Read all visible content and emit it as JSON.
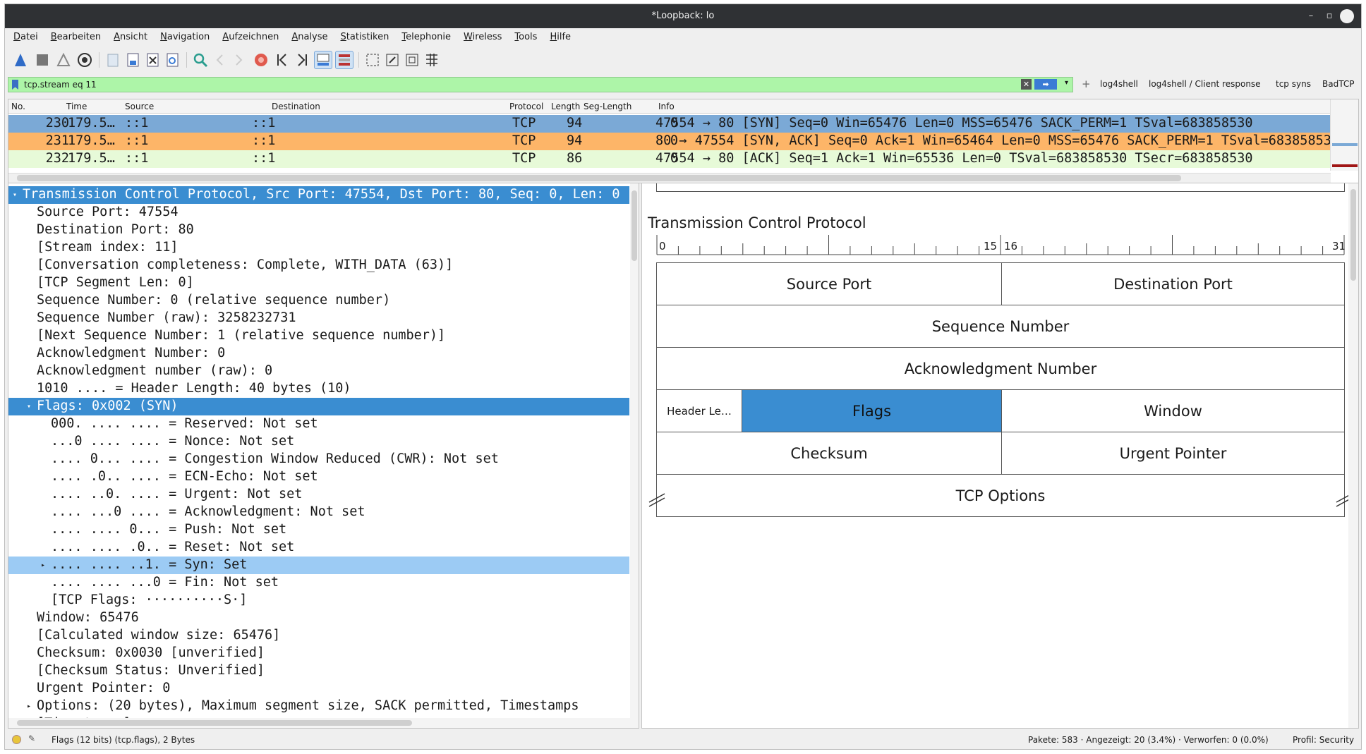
{
  "window": {
    "title": "*Loopback: lo",
    "minimize": "–",
    "maximize": "▫"
  },
  "menu": [
    "Datei",
    "Bearbeiten",
    "Ansicht",
    "Navigation",
    "Aufzeichnen",
    "Analyse",
    "Statistiken",
    "Telephonie",
    "Wireless",
    "Tools",
    "Hilfe"
  ],
  "filter": {
    "value": "tcp.stream eq 11",
    "add": "+",
    "buttons": [
      "log4shell",
      "log4shell / Client response",
      "tcp syns",
      "BadTCP"
    ]
  },
  "packet_list": {
    "columns": [
      "No.",
      "Time",
      "Source",
      "Destination",
      "Protocol",
      "Length",
      "Seg-Length",
      "Info"
    ],
    "rows": [
      {
        "no": "230",
        "time": "179.5…",
        "src": "::1",
        "dst": "::1",
        "proto": "TCP",
        "len": "94",
        "seglen": "0",
        "info": "47554 → 80 [SYN] Seq=0 Win=65476 Len=0 MSS=65476 SACK_PERM=1 TSval=683858530",
        "color": "#7ba9d6"
      },
      {
        "no": "231",
        "time": "179.5…",
        "src": "::1",
        "dst": "::1",
        "proto": "TCP",
        "len": "94",
        "seglen": "0",
        "info": "80 → 47554 [SYN, ACK] Seq=0 Ack=1 Win=65464 Len=0 MSS=65476 SACK_PERM=1 TSval=683858530",
        "color": "#fdb568"
      },
      {
        "no": "232",
        "time": "179.5…",
        "src": "::1",
        "dst": "::1",
        "proto": "TCP",
        "len": "86",
        "seglen": "0",
        "info": "47554 → 80 [ACK] Seq=1 Ack=1 Win=65536 Len=0 TSval=683858530 TSecr=683858530",
        "color": "#e7fad8"
      }
    ]
  },
  "tree": [
    "Transmission Control Protocol, Src Port: 47554, Dst Port: 80, Seq: 0, Len: 0",
    "Source Port: 47554",
    "Destination Port: 80",
    "[Stream index: 11]",
    "[Conversation completeness: Complete, WITH_DATA (63)]",
    "[TCP Segment Len: 0]",
    "Sequence Number: 0    (relative sequence number)",
    "Sequence Number (raw): 3258232731",
    "[Next Sequence Number: 1    (relative sequence number)]",
    "Acknowledgment Number: 0",
    "Acknowledgment number (raw): 0",
    "1010 .... = Header Length: 40 bytes (10)",
    "Flags: 0x002 (SYN)",
    "000. .... .... = Reserved: Not set",
    "...0 .... .... = Nonce: Not set",
    ".... 0... .... = Congestion Window Reduced (CWR): Not set",
    ".... .0.. .... = ECN-Echo: Not set",
    ".... ..0. .... = Urgent: Not set",
    ".... ...0 .... = Acknowledgment: Not set",
    ".... .... 0... = Push: Not set",
    ".... .... .0.. = Reset: Not set",
    ".... .... ..1. = Syn: Set",
    ".... .... ...0 = Fin: Not set",
    "[TCP Flags: ··········S·]",
    "Window: 65476",
    "[Calculated window size: 65476]",
    "Checksum: 0x0030 [unverified]",
    "[Checksum Status: Unverified]",
    "Urgent Pointer: 0",
    "Options: (20 bytes), Maximum segment size, SACK permitted, Timestamps",
    "[Timestamps]"
  ],
  "diagram": {
    "title": "Transmission Control Protocol",
    "bit_labels": [
      "0",
      "15",
      "16",
      "31"
    ],
    "fields": {
      "src_port": "Source Port",
      "dst_port": "Destination Port",
      "seq": "Sequence Number",
      "ack": "Acknowledgment Number",
      "hdr_len": "Header Le…",
      "flags": "Flags",
      "window": "Window",
      "checksum": "Checksum",
      "urgent": "Urgent Pointer",
      "options": "TCP Options"
    }
  },
  "status": {
    "field": "Flags (12 bits) (tcp.flags), 2 Bytes",
    "stats": "Pakete: 583 · Angezeigt: 20 (3.4%) · Verworfen: 0 (0.0%)",
    "profile": "Profil: Security"
  }
}
